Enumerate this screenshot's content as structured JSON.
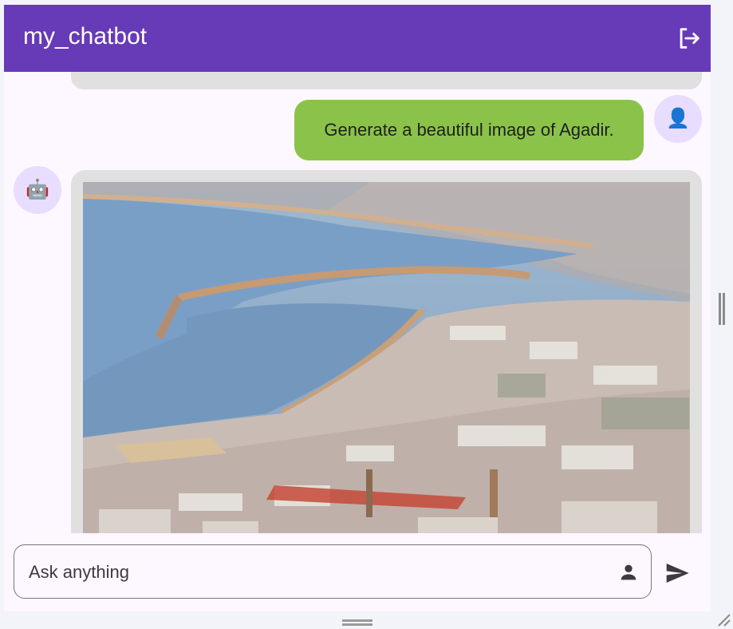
{
  "app": {
    "title": "my_chatbot"
  },
  "messages": [
    {
      "role": "user",
      "text": "Generate a beautiful image of Agadir.",
      "avatar_icon": "person-icon"
    },
    {
      "role": "bot",
      "content": "image",
      "avatar_icon": "robot-icon"
    }
  ],
  "input": {
    "placeholder": "Ask anything",
    "value": ""
  },
  "icons": {
    "logout": "logout-icon",
    "person": "person-icon",
    "send": "send-icon",
    "user_avatar": "👤",
    "bot_avatar": "🤖"
  },
  "colors": {
    "appbar": "#673ab7",
    "user_bubble": "#8bc34a",
    "bot_bubble": "#e0e0e0",
    "avatar_bg": "#e8ddff",
    "background": "#fdf7ff"
  }
}
